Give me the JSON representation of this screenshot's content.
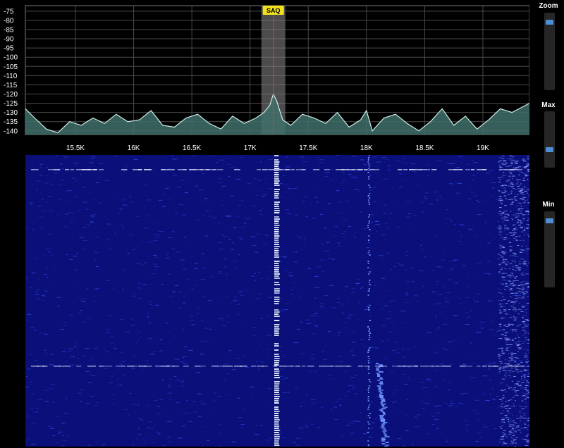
{
  "spectrum": {
    "y_ticks": [
      "-75",
      "-80",
      "-85",
      "-90",
      "-95",
      "-100",
      "-105",
      "-110",
      "-115",
      "-120",
      "-125",
      "-130",
      "-135",
      "-140"
    ],
    "x_ticks": [
      "15.5K",
      "16K",
      "16.5K",
      "17K",
      "17.5K",
      "18K",
      "18.5K",
      "19K"
    ],
    "marker": {
      "label": "SAQ"
    },
    "colors": {
      "trace": "#cfeee8",
      "fill": "#3f6f6a",
      "grid": "#4a4a4a",
      "marker_line": "#ff3030",
      "marker_label_bg": "#f2e21a"
    }
  },
  "chart_data": {
    "type": "area",
    "title": "",
    "xlabel": "",
    "ylabel": "",
    "xlim": [
      15.07,
      19.4
    ],
    "ylim": [
      -142,
      -72
    ],
    "x_tick_values": [
      15.5,
      16,
      16.5,
      17,
      17.5,
      18,
      18.5,
      19
    ],
    "y_tick_values": [
      -75,
      -80,
      -85,
      -90,
      -95,
      -100,
      -105,
      -110,
      -115,
      -120,
      -125,
      -130,
      -135,
      -140
    ],
    "marker": {
      "label": "SAQ",
      "x": 17.2
    },
    "x": [
      15.07,
      15.15,
      15.25,
      15.35,
      15.45,
      15.55,
      15.65,
      15.75,
      15.85,
      15.95,
      16.05,
      16.15,
      16.25,
      16.35,
      16.45,
      16.55,
      16.65,
      16.75,
      16.85,
      16.95,
      17.05,
      17.12,
      17.17,
      17.2,
      17.23,
      17.28,
      17.35,
      17.45,
      17.55,
      17.65,
      17.75,
      17.85,
      17.95,
      18.0,
      18.05,
      18.15,
      18.25,
      18.35,
      18.45,
      18.55,
      18.65,
      18.75,
      18.85,
      18.95,
      19.05,
      19.15,
      19.25,
      19.4
    ],
    "y": [
      -128,
      -133,
      -139,
      -141,
      -135,
      -137,
      -133,
      -136,
      -131,
      -135,
      -134,
      -129,
      -137,
      -138,
      -133,
      -131,
      -136,
      -139,
      -132,
      -136,
      -133,
      -130,
      -126,
      -120,
      -124,
      -134,
      -137,
      -131,
      -133,
      -136,
      -130,
      -138,
      -134,
      -129,
      -140,
      -133,
      -131,
      -136,
      -140,
      -135,
      -128,
      -137,
      -132,
      -139,
      -134,
      -128,
      -130,
      -125
    ]
  },
  "waterfall": {
    "colors": {
      "background": "#0a0f7a",
      "carrier": "#e6f0ff",
      "noise": "#2f4ff0"
    }
  },
  "controls": {
    "zoom": {
      "label": "Zoom",
      "level": 0.1
    },
    "max": {
      "label": "Max",
      "level": 0.7
    },
    "min": {
      "label": "Min",
      "level": 0.1
    },
    "track_color": "#262626",
    "thumb_color": "#4d8fd6"
  }
}
